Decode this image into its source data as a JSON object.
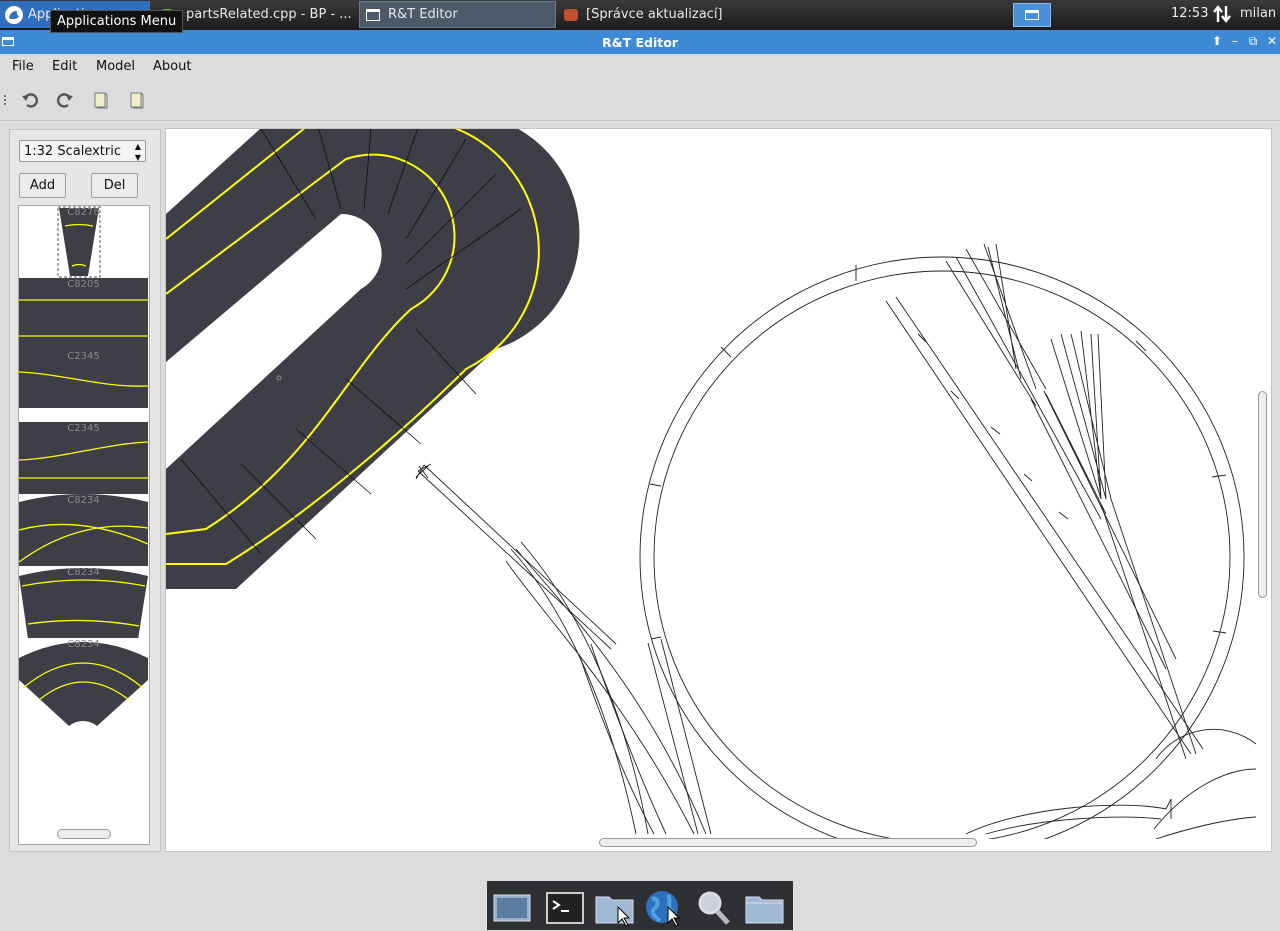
{
  "taskbar": {
    "apps_label": "Applications",
    "tooltip": "Applications Menu",
    "tasks": [
      "partsRelated.cpp - BP - ...",
      "R&T Editor",
      "[Správce aktualizací]"
    ],
    "clock": "12:53",
    "user": "milan"
  },
  "window": {
    "title": "R&T Editor"
  },
  "menu": [
    "File",
    "Edit",
    "Model",
    "About"
  ],
  "toolbar": {
    "icons": [
      "undo-icon",
      "redo-icon",
      "document-icon",
      "document-icon"
    ]
  },
  "left_panel": {
    "scale": "1:32 Scalextric",
    "add_label": "Add",
    "del_label": "Del",
    "parts": [
      "C8278",
      "C8205",
      "C2345",
      "C2345",
      "C8234",
      "C8234",
      "C8234"
    ]
  },
  "colors": {
    "track": "#3d3e46",
    "lane": "#ffff00",
    "titlebar": "#3e8ad6",
    "panel_bg": "#dcdcdc"
  },
  "dock": {
    "icons": [
      "desktop-icon",
      "terminal-icon",
      "home-folder-icon",
      "browser-icon",
      "search-icon",
      "folder-icon"
    ]
  }
}
